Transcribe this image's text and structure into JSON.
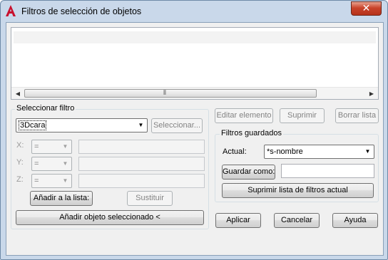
{
  "window": {
    "title": "Filtros de selección de objetos",
    "close_glyph": "✕"
  },
  "list": {
    "rows": [
      ""
    ],
    "scroll_grip": "⦀"
  },
  "select_filter": {
    "group_label": "Seleccionar filtro",
    "combo_value": "3Dcara",
    "select_button": "Seleccionar...",
    "x_label": "X:",
    "y_label": "Y:",
    "z_label": "Z:",
    "x_op": "=",
    "y_op": "=",
    "z_op": "=",
    "add_to_list": "Añadir a la lista:",
    "substitute": "Sustituir",
    "add_selected": "Añadir objeto seleccionado <"
  },
  "edit_buttons": {
    "edit": "Editar elemento",
    "delete": "Suprimir",
    "clear": "Borrar lista"
  },
  "saved_filters": {
    "group_label": "Filtros guardados",
    "current_label": "Actual:",
    "current_value": "*s-nombre",
    "save_as": "Guardar como:",
    "save_as_value": "",
    "delete_current": "Suprimir lista de filtros actual"
  },
  "footer": {
    "apply": "Aplicar",
    "cancel": "Cancelar",
    "help": "Ayuda"
  }
}
